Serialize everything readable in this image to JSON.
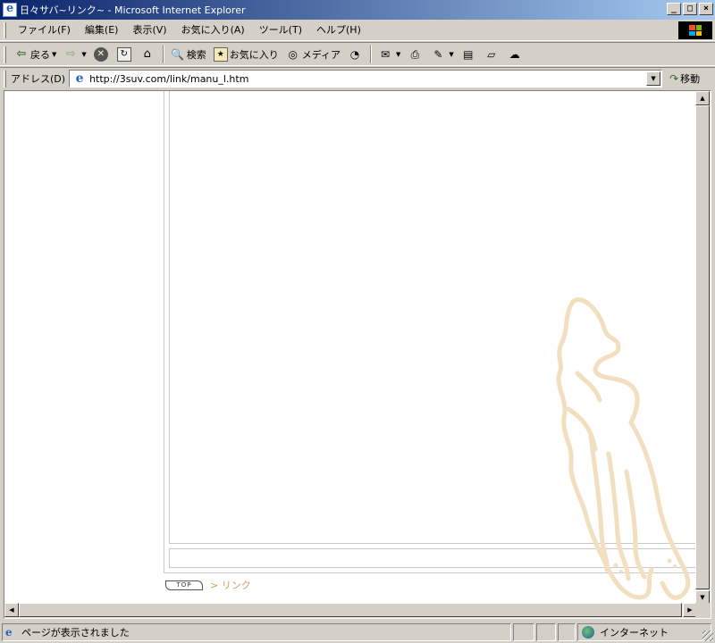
{
  "window": {
    "title": "日々サバ~リンク~ - Microsoft Internet Explorer",
    "minimize": "_",
    "maximize": "□",
    "close": "×"
  },
  "menu": {
    "items": [
      "ファイル(F)",
      "編集(E)",
      "表示(V)",
      "お気に入り(A)",
      "ツール(T)",
      "ヘルプ(H)"
    ]
  },
  "toolbar": {
    "back_label": "戻る",
    "search_label": "検索",
    "favorites_label": "お気に入り",
    "media_label": "メディア"
  },
  "address": {
    "label": "アドレス(D)",
    "url": "http://3suv.com/link/manu_l.htm",
    "go_label": "移動"
  },
  "page": {
    "top_button": "TOP",
    "breadcrumb": "> リンク",
    "breadcrumb_color": "#d79a5a",
    "illustration_color": "#f1dfc0"
  },
  "status": {
    "text": "ページが表示されました",
    "zone": "インターネット"
  }
}
